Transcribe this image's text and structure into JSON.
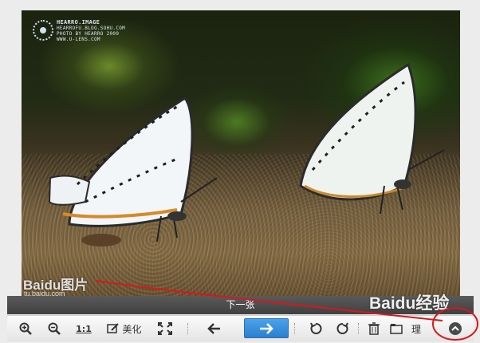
{
  "photo": {
    "credit_lines": [
      "HEARRO.IMAGE",
      "HEARROFU.BLOG.SOHU.COM",
      "PHOTO BY HEARRO 2009",
      "WWW.U-LENS.COM"
    ],
    "watermark": "Baidu图片",
    "watermark_url": "tu.baidu.com"
  },
  "next_bar": {
    "label": "下一张"
  },
  "toolbar": {
    "one_to_one": "1:1",
    "beautify": "美化",
    "manage": "理"
  },
  "overlay": {
    "experience_watermark": "Baidu经验",
    "annotation_color": "#d8171c"
  }
}
